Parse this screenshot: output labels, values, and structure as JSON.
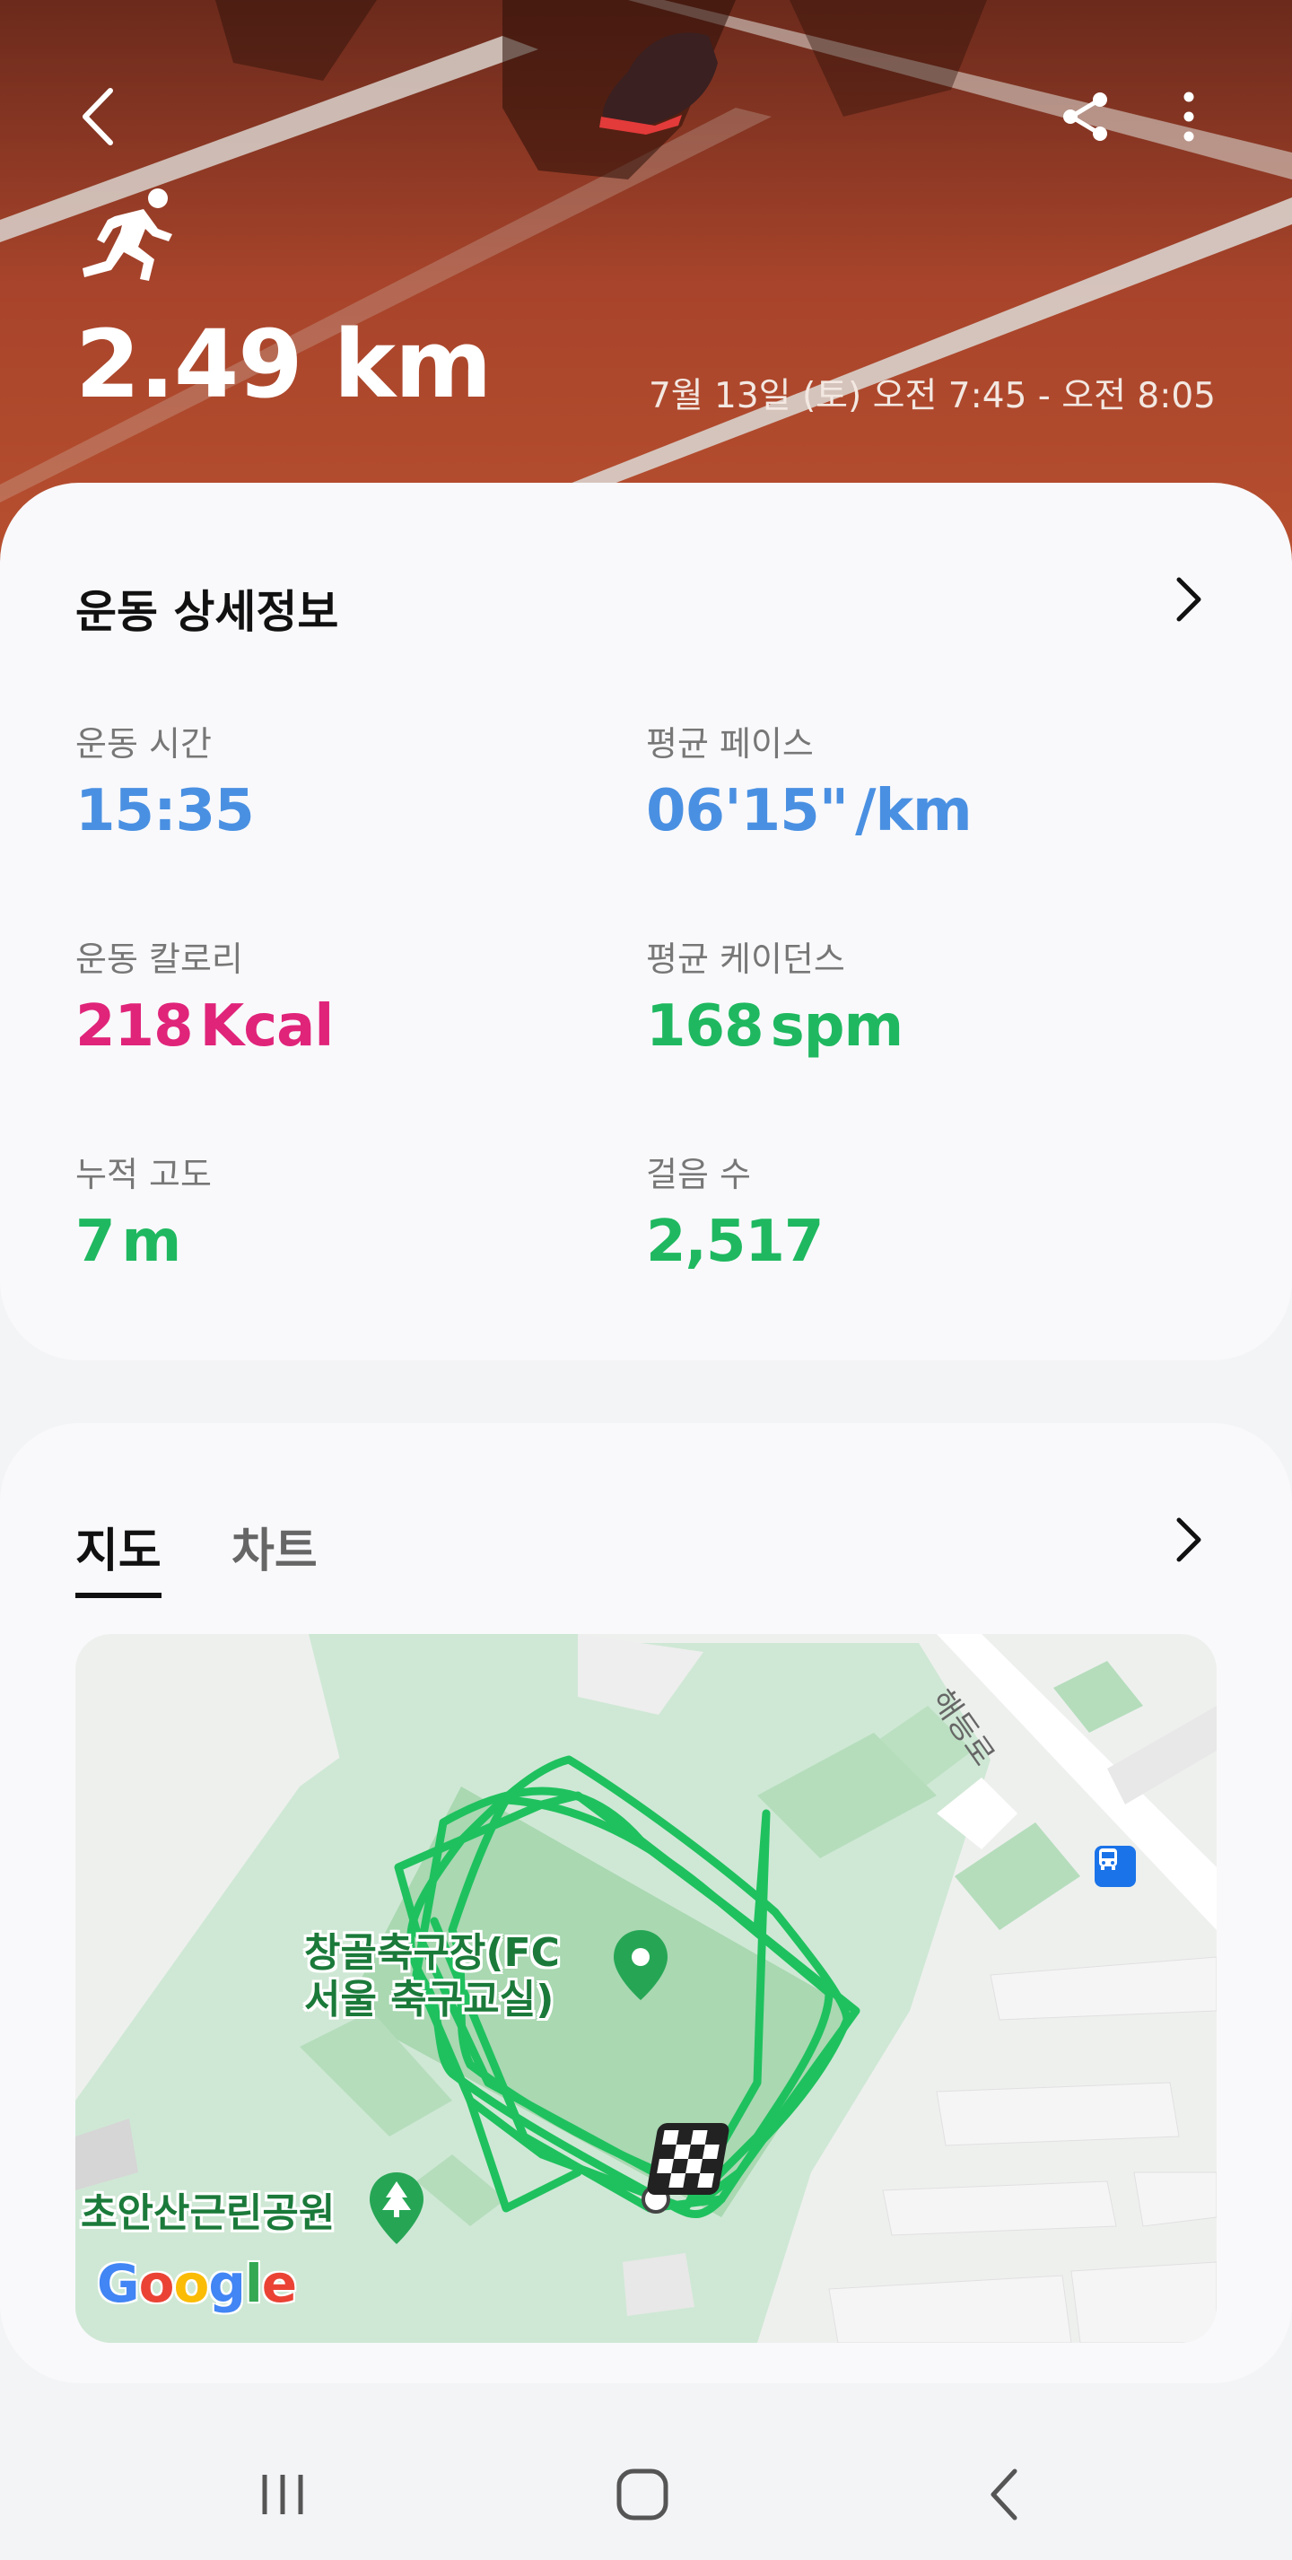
{
  "hero": {
    "distance": "2.49 km",
    "date_range": "7월 13일 (토) 오전 7:45 - 오전 8:05",
    "icons": {
      "back": "back-arrow-icon",
      "share": "share-icon",
      "more": "more-vertical-icon",
      "activity": "running-icon"
    }
  },
  "details": {
    "title": "운동 상세정보",
    "stats": [
      {
        "label": "운동 시간",
        "value": "15:35",
        "unit": "",
        "color": "#4a90e2"
      },
      {
        "label": "평균 페이스",
        "value": "06'15\"",
        "unit": "/km",
        "color": "#4a90e2"
      },
      {
        "label": "운동 칼로리",
        "value": "218",
        "unit": "Kcal",
        "color": "#e0247a"
      },
      {
        "label": "평균 케이던스",
        "value": "168",
        "unit": "spm",
        "color": "#1fb860"
      },
      {
        "label": "누적 고도",
        "value": "7",
        "unit": "m",
        "color": "#1fb860"
      },
      {
        "label": "걸음 수",
        "value": "2,517",
        "unit": "",
        "color": "#1fb860"
      }
    ]
  },
  "map_section": {
    "tabs": [
      "지도",
      "차트"
    ],
    "active_tab": "지도",
    "map": {
      "place_label_line1": "창골축구장(FC",
      "place_label_line2": "서울 축구교실)",
      "park_label": "초안산근린공원",
      "road_label": "해등로",
      "attribution": "Google",
      "route_color": "#1fc15e"
    }
  },
  "navbar": {
    "icons": [
      "recent-apps-icon",
      "home-icon",
      "back-icon"
    ]
  }
}
